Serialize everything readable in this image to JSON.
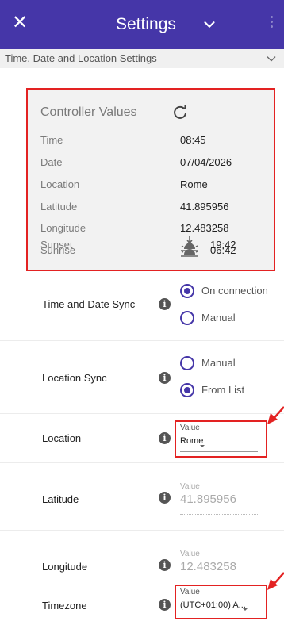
{
  "header": {
    "title": "Settings",
    "section_title": "Time, Date and Location Settings"
  },
  "controller": {
    "title": "Controller Values",
    "rows": [
      {
        "label": "Time",
        "value": "08:45"
      },
      {
        "label": "Date",
        "value": "07/04/2026"
      },
      {
        "label": "Location",
        "value": "Rome"
      },
      {
        "label": "Latitude",
        "value": "41.895956"
      },
      {
        "label": "Longitude",
        "value": "12.483258"
      },
      {
        "label": "Sunrise",
        "value": "06:42"
      },
      {
        "label": "Sunset",
        "value": "19:42"
      }
    ]
  },
  "settings": {
    "time_date_sync": {
      "label": "Time and Date Sync",
      "options": [
        "On connection",
        "Manual"
      ],
      "selected": "On connection"
    },
    "location_sync": {
      "label": "Location Sync",
      "options": [
        "Manual",
        "From List"
      ],
      "selected": "From List"
    },
    "location": {
      "label": "Location",
      "caption": "Value",
      "value": "Rome"
    },
    "latitude": {
      "label": "Latitude",
      "caption": "Value",
      "value": "41.895956"
    },
    "longitude": {
      "label": "Longitude",
      "caption": "Value",
      "value": "12.483258"
    },
    "timezone": {
      "label": "Timezone",
      "caption": "Value",
      "value": "(UTC+01:00) A..."
    }
  },
  "colors": {
    "app_bar": "#4536a8",
    "accent": "#4536a8",
    "highlight": "#e32222"
  },
  "icons": {
    "close": "close-icon",
    "title_dropdown": "chevron-down-icon",
    "menu": "more-vert-icon",
    "refresh": "refresh-icon",
    "sunrise": "sunrise-icon",
    "sunset": "sunset-icon",
    "info": "info-icon"
  }
}
